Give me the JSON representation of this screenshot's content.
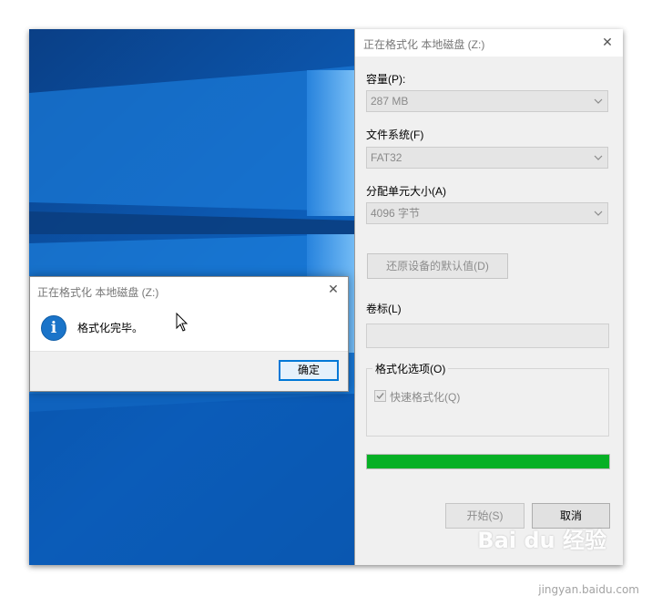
{
  "format_window": {
    "title": "正在格式化 本地磁盘 (Z:)",
    "close_glyph": "✕",
    "capacity_label": "容量(P):",
    "capacity_value": "287 MB",
    "filesystem_label": "文件系统(F)",
    "filesystem_value": "FAT32",
    "allocation_label": "分配单元大小(A)",
    "allocation_value": "4096 字节",
    "restore_defaults_label": "还原设备的默认值(D)",
    "volume_label": "卷标(L)",
    "volume_value": "",
    "format_options_label": "格式化选项(O)",
    "quick_format_label": "快速格式化(Q)",
    "quick_format_checked": true,
    "progress_fraction": 1.0,
    "progress_color": "#06b025",
    "start_button": "开始(S)",
    "cancel_button": "取消"
  },
  "message_dialog": {
    "title": "正在格式化 本地磁盘 (Z:)",
    "close_glyph": "✕",
    "icon": "info-icon",
    "icon_glyph": "i",
    "message": "格式化完毕。",
    "ok_button": "确定"
  },
  "watermark": {
    "brand": "Bai du 经验",
    "url": "jingyan.baidu.com"
  },
  "colors": {
    "desktop_blue": "#0b5cb5",
    "accent": "#0078d7"
  }
}
